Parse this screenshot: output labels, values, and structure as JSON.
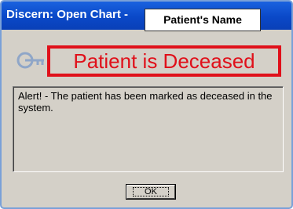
{
  "window": {
    "title": "Discern: Open Chart -",
    "patient_name": "Patient's Name"
  },
  "alert": {
    "icon": "arrow-key-icon",
    "headline": "Patient is Deceased",
    "headline_color": "#e0101a",
    "message": "Alert! - The patient has been marked as deceased in the system."
  },
  "buttons": {
    "ok_label": "OK"
  }
}
